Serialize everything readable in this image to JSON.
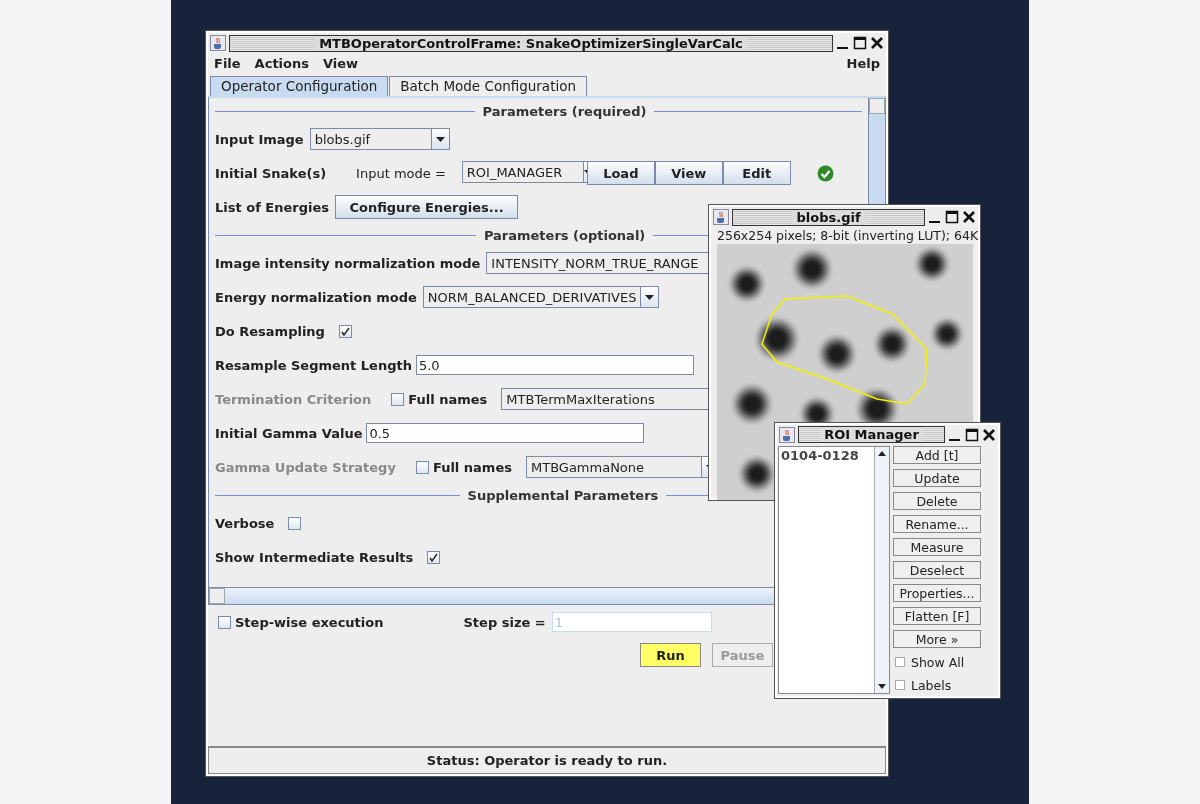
{
  "main_window": {
    "title": "MTBOperatorControlFrame: SnakeOptimizerSingleVarCalc",
    "menu": [
      "File",
      "Actions",
      "View"
    ],
    "help_menu": "Help",
    "tabs": [
      {
        "label": "Operator Configuration",
        "selected": true
      },
      {
        "label": "Batch Mode Configuration",
        "selected": false
      }
    ],
    "sections": [
      {
        "title": "Parameters (required)",
        "rows": [
          {
            "kind": "combo",
            "label": "Input Image",
            "value": "blobs.gif"
          },
          {
            "kind": "snake",
            "label": "Initial Snake(s)",
            "mode_label": "Input mode =",
            "value": "ROI_MANAGER",
            "buttons": [
              "Load",
              "View",
              "Edit"
            ],
            "valid": true
          },
          {
            "kind": "button",
            "label": "List of Energies",
            "button": "Configure Energies..."
          }
        ]
      },
      {
        "title": "Parameters (optional)",
        "rows": [
          {
            "kind": "combo",
            "label": "Image intensity normalization mode",
            "value": "INTENSITY_NORM_TRUE_RANGE"
          },
          {
            "kind": "combo",
            "label": "Energy normalization mode",
            "value": "NORM_BALANCED_DERIVATIVES"
          },
          {
            "kind": "check",
            "label": "Do Resampling",
            "checked": true
          },
          {
            "kind": "text",
            "label": "Resample Segment Length",
            "value": "5.0"
          },
          {
            "kind": "choice",
            "label": "Termination Criterion",
            "disabled": true,
            "option_label": "Full names",
            "checked": false,
            "value": "MTBTermMaxIterations"
          },
          {
            "kind": "text",
            "label": "Initial Gamma Value",
            "value": "0.5"
          },
          {
            "kind": "choice",
            "label": "Gamma Update Strategy",
            "disabled": true,
            "option_label": "Full names",
            "checked": false,
            "value": "MTBGammaNone"
          }
        ]
      },
      {
        "title": "Supplemental Parameters",
        "rows": [
          {
            "kind": "check",
            "label": "Verbose",
            "checked": false
          },
          {
            "kind": "check",
            "label": "Show Intermediate Results",
            "checked": true
          }
        ]
      }
    ],
    "step_wise": {
      "label": "Step-wise execution",
      "checked": false
    },
    "step_size": {
      "label": "Step size =",
      "value": "1",
      "disabled": true
    },
    "buttons": [
      {
        "label": "Run",
        "disabled": false
      },
      {
        "label": "Pause",
        "disabled": true
      }
    ],
    "status": "Status: Operator is ready to run."
  },
  "image_window": {
    "title": "blobs.gif",
    "info": "256x254 pixels; 8-bit (inverting LUT); 64K"
  },
  "roi_manager": {
    "title": "ROI Manager",
    "items": [
      {
        "label": "0104-0128",
        "selected": false
      }
    ],
    "buttons": [
      "Add [t]",
      "Update",
      "Delete",
      "Rename...",
      "Measure",
      "Deselect",
      "Properties...",
      "Flatten [F]",
      "More »"
    ],
    "options": [
      {
        "label": "Show All",
        "checked": false
      },
      {
        "label": "Labels",
        "checked": false
      }
    ]
  }
}
